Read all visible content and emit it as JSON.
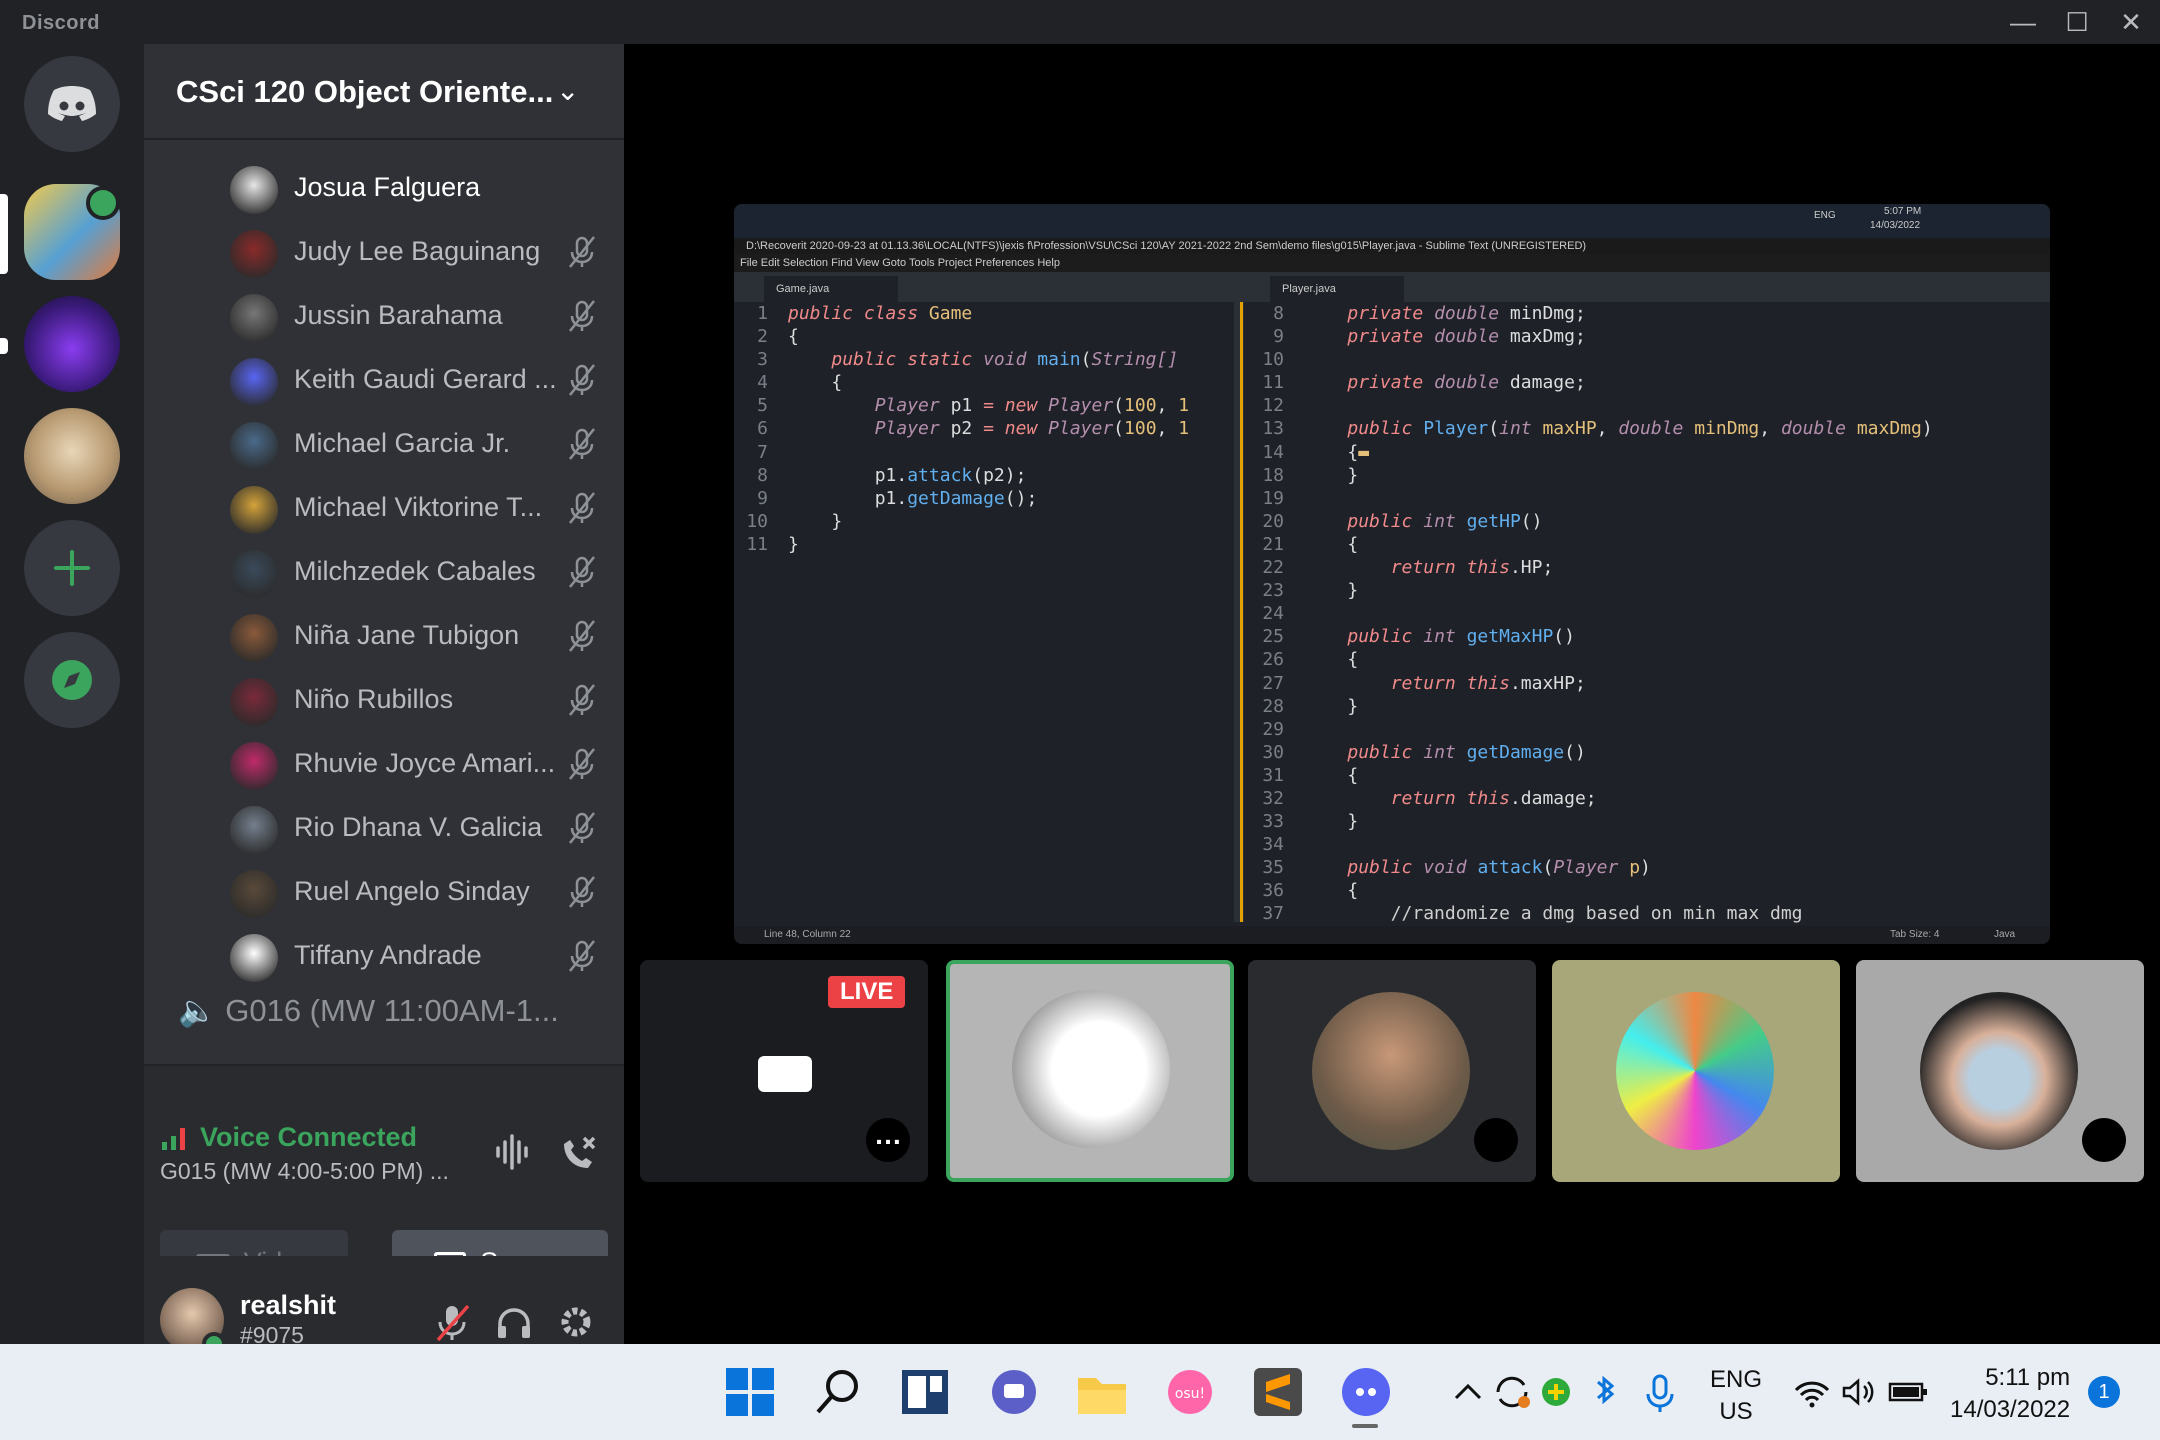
{
  "app": {
    "brand": "Discord"
  },
  "window_controls": {
    "minimize": "—",
    "maximize": "☐",
    "close": "✕"
  },
  "server": {
    "name": "CSci 120 Object Oriente..."
  },
  "members": [
    {
      "name": "Josua Falguera",
      "active": true
    },
    {
      "name": "Judy Lee Baguinang"
    },
    {
      "name": "Jussin Barahama"
    },
    {
      "name": "Keith Gaudi Gerard ..."
    },
    {
      "name": "Michael Garcia Jr."
    },
    {
      "name": "Michael Viktorine T..."
    },
    {
      "name": "Milchzedek Cabales"
    },
    {
      "name": "Niña Jane Tubigon"
    },
    {
      "name": "Niño Rubillos"
    },
    {
      "name": "Rhuvie Joyce Amari..."
    },
    {
      "name": "Rio Dhana V. Galicia"
    },
    {
      "name": "Ruel Angelo Sinday"
    },
    {
      "name": "Tiffany Andrade"
    }
  ],
  "other_channel": "G016 (MW 11:00AM-1...",
  "voice": {
    "status": "Voice Connected",
    "channel": "G015 (MW 4:00-5:00 PM) ...",
    "video_label": "Video",
    "screen_label": "Screen"
  },
  "user": {
    "name": "realshit",
    "tag": "#9075"
  },
  "stream": {
    "window_title": "D:\\Recoverit 2020-09-23 at 01.13.36\\LOCAL(NTFS)\\jexis f\\Profession\\VSU\\CSci 120\\AY 2021-2022 2nd Sem\\demo files\\g015\\Player.java - Sublime Text (UNREGISTERED)",
    "menu": "File   Edit   Selection   Find   View   Goto   Tools   Project   Preferences   Help",
    "tab_left": "Game.java",
    "tab_right": "Player.java",
    "remote_time": "5:07 PM",
    "remote_date": "14/03/2022",
    "remote_lang": "ENG",
    "status_left": "Line 48, Column 22",
    "status_tab": "Tab Size: 4",
    "status_lang": "Java"
  },
  "live_badge": "LIVE",
  "taskbar": {
    "lang1": "ENG",
    "lang2": "US",
    "time": "5:11 pm",
    "date": "14/03/2022",
    "notif": "1"
  }
}
